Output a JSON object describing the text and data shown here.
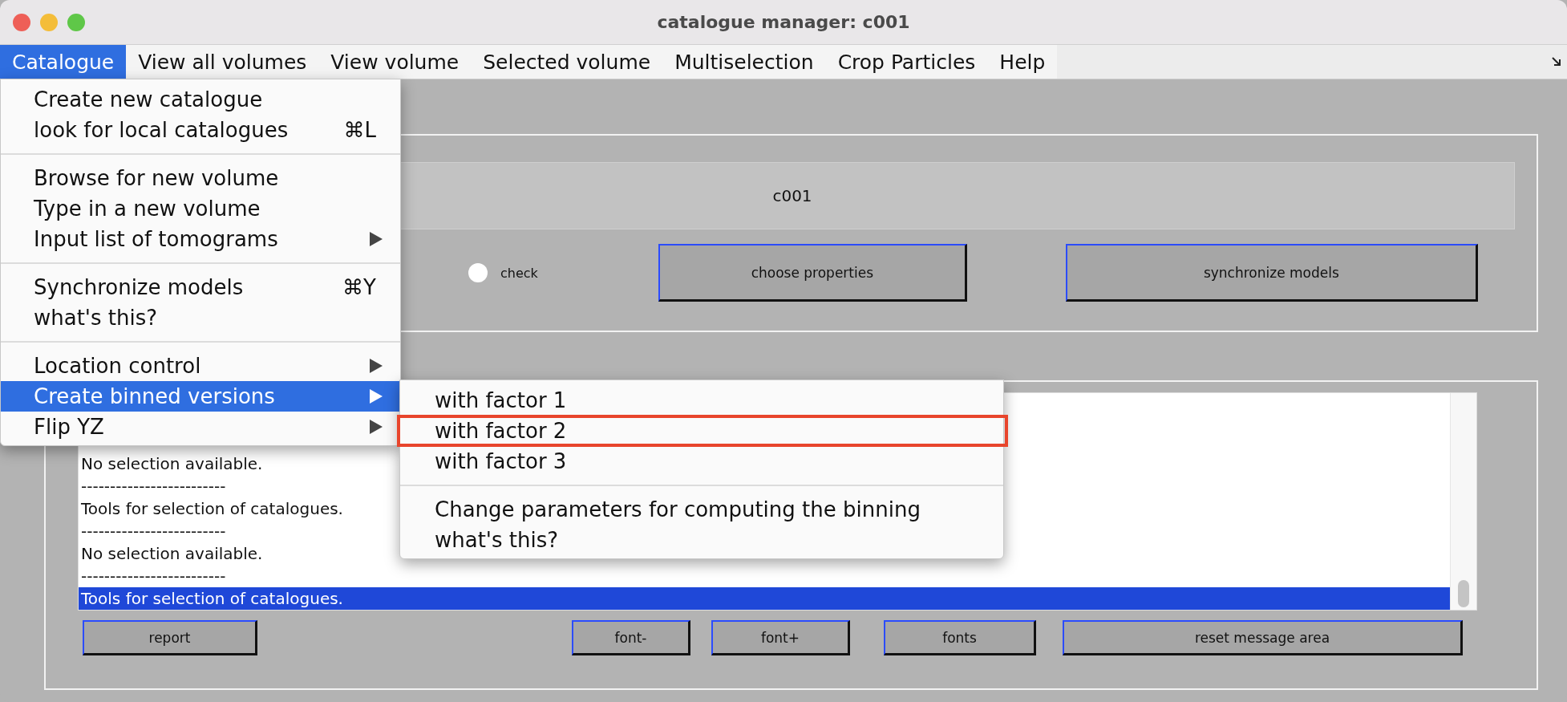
{
  "window": {
    "title": "catalogue manager: c001"
  },
  "menubar": [
    {
      "label": "Catalogue",
      "selected": true
    },
    {
      "label": "View all volumes",
      "selected": false
    },
    {
      "label": "View volume",
      "selected": false
    },
    {
      "label": "Selected volume",
      "selected": false
    },
    {
      "label": "Multiselection",
      "selected": false
    },
    {
      "label": "Crop Particles",
      "selected": false
    },
    {
      "label": "Help",
      "selected": false
    }
  ],
  "menu": {
    "items": [
      {
        "kind": "item",
        "label": "Create new catalogue",
        "selected": false
      },
      {
        "kind": "item",
        "label": "look for local catalogues",
        "shortcut": "⌘L",
        "selected": false
      },
      {
        "kind": "separator"
      },
      {
        "kind": "item",
        "label": "Browse for new volume",
        "selected": false
      },
      {
        "kind": "item",
        "label": "Type in a new volume",
        "selected": false
      },
      {
        "kind": "item",
        "label": "Input list of tomograms",
        "submenu": true,
        "selected": false
      },
      {
        "kind": "separator"
      },
      {
        "kind": "item",
        "label": "Synchronize models",
        "shortcut": "⌘Y",
        "selected": false
      },
      {
        "kind": "item",
        "label": "what's this?",
        "selected": false
      },
      {
        "kind": "separator"
      },
      {
        "kind": "item",
        "label": "Location control",
        "submenu": true,
        "selected": false
      },
      {
        "kind": "item",
        "label": "Create binned versions",
        "submenu": true,
        "selected": true
      },
      {
        "kind": "item",
        "label": "Flip YZ",
        "submenu": true,
        "selected": false
      }
    ]
  },
  "submenu": {
    "items": [
      {
        "kind": "item",
        "label": "with factor 1",
        "highlighted": false
      },
      {
        "kind": "item",
        "label": "with factor 2",
        "highlighted": true
      },
      {
        "kind": "item",
        "label": "with factor 3",
        "highlighted": false
      },
      {
        "kind": "separator"
      },
      {
        "kind": "item",
        "label": "Change parameters for computing the binning",
        "highlighted": false
      },
      {
        "kind": "item",
        "label": "what's this?",
        "highlighted": false
      }
    ]
  },
  "catalogue_name": {
    "value": "c001"
  },
  "check": {
    "label": "check",
    "checked": false
  },
  "top_buttons": [
    "choose properties",
    "synchronize models"
  ],
  "messages": [
    {
      "text": "No selection available.",
      "selected": false
    },
    {
      "text": "-------------------------",
      "selected": false
    },
    {
      "text": "Tools for selection of catalogues.",
      "selected": false
    },
    {
      "text": "-------------------------",
      "selected": false
    },
    {
      "text": "No selection available.",
      "selected": false
    },
    {
      "text": "-------------------------",
      "selected": false
    },
    {
      "text": "Tools for selection of catalogues.",
      "selected": true
    }
  ],
  "bottom_buttons": [
    "report",
    "font-",
    "font+",
    "fonts",
    "reset message area"
  ]
}
